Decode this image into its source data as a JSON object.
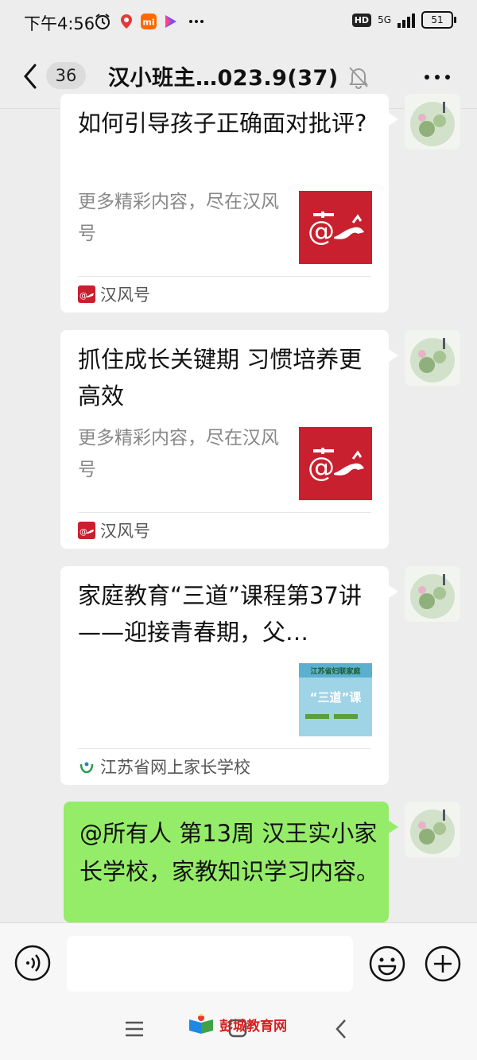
{
  "status_bar": {
    "time": "下午4:56",
    "network": "5G",
    "hd": "HD",
    "battery": "51"
  },
  "header": {
    "unread_count": "36",
    "title": "汉小班主…023.9(37)"
  },
  "messages": [
    {
      "type": "link-card",
      "title": "如何引导孩子正确面对批评?",
      "description": "更多精彩内容，尽在汉风号",
      "source": "汉风号",
      "thumbnail": "hanfeng-logo"
    },
    {
      "type": "link-card",
      "title": "抓住成长关键期 习惯培养更高效",
      "description": "更多精彩内容，尽在汉风号",
      "source": "汉风号",
      "thumbnail": "hanfeng-logo"
    },
    {
      "type": "link-card",
      "title": "家庭教育“三道”课程第37讲——迎接青春期，父…",
      "description": "",
      "source": "江苏省网上家长学校",
      "thumbnail": "sandao-course",
      "thumb_texts": [
        "江苏省妇联家庭",
        "“三道”课"
      ]
    },
    {
      "type": "text",
      "text": "@所有人  第13周 汉王实小家长学校，家教知识学习内容。"
    }
  ],
  "input": {
    "value": "",
    "placeholder": ""
  },
  "watermark": {
    "text": "彭城教育网"
  },
  "colors": {
    "background": "#ededed",
    "bubble_green": "#95ec69",
    "hanfeng_red": "#c8202f"
  },
  "icons": [
    "back-icon",
    "bell-muted-icon",
    "more-icon",
    "voice-icon",
    "emoji-icon",
    "plus-icon",
    "nav-menu-icon",
    "nav-home-icon",
    "nav-back-icon"
  ]
}
